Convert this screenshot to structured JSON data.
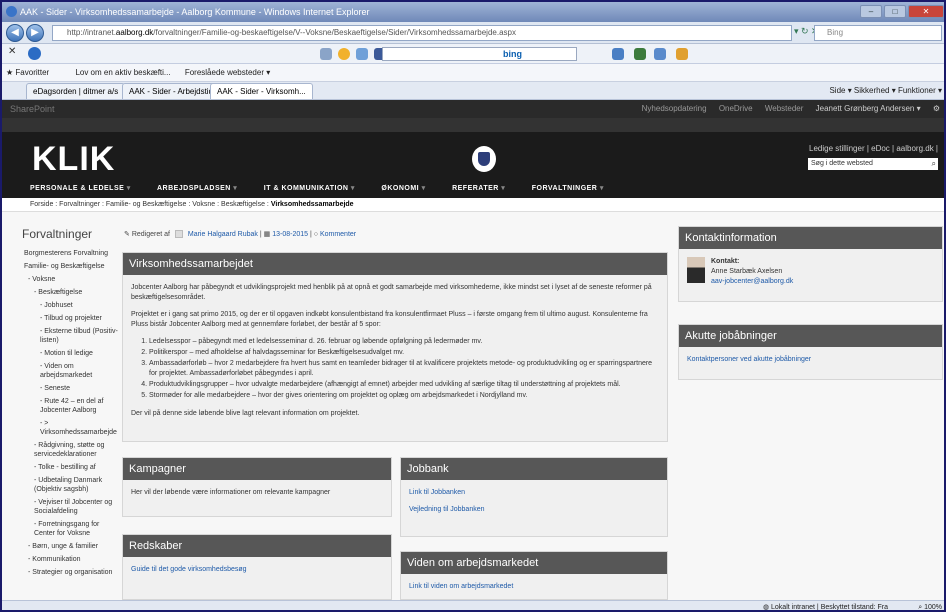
{
  "browser": {
    "title": "AAK - Sider - Virksomhedssamarbejde - Aalborg Kommune - Windows Internet Explorer",
    "url_prefix": "http://intranet.",
    "url_host": "aalborg.dk",
    "url_path": "/forvaltninger/Familie-og-beskaeftigelse/V--Voksne/Beskaeftigelse/Sider/Virksomhedssamarbejde.aspx",
    "search_placeholder": "Bing",
    "bing_label": "bing",
    "favorites_label": "Favoritter",
    "fav_items": [
      "Lov om en aktiv beskæfti...",
      "Foreslåede websteder ▾"
    ],
    "tabs": [
      "eDagsorden | ditmer a/s",
      "AAK - Sider - Arbejdstid - ...",
      "AAK - Sider - Virksomh..."
    ],
    "command_bar": "Side ▾   Sikkerhed ▾   Funktioner ▾",
    "status_zone": "Lokalt intranet | Beskyttet tilstand: Fra",
    "status_zoom": "100%"
  },
  "suite": {
    "brand": "SharePoint",
    "links": [
      "Nyhedsopdatering",
      "OneDrive",
      "Websteder"
    ],
    "user": "Jeanett Grønberg Andersen ▾"
  },
  "site": {
    "logo": "KLIK",
    "top_links": "Ledige stillinger  |  eDoc  |  aalborg.dk  |",
    "search_placeholder": "Søg i dette websted",
    "nav": [
      "PERSONALE & LEDELSE",
      "ARBEJDSPLADSEN",
      "IT & KOMMUNIKATION",
      "ØKONOMI",
      "REFERATER",
      "FORVALTNINGER"
    ]
  },
  "breadcrumb": {
    "path": "Forside : Forvaltninger : Familie- og Beskæftigelse : Voksne : Beskæftigelse : ",
    "current": "Virksomhedssamarbejde"
  },
  "leftnav": {
    "heading": "Forvaltninger",
    "items": [
      {
        "label": "Borgmesterens Forvaltning",
        "level": 1
      },
      {
        "label": "Familie- og Beskæftigelse",
        "level": 1
      },
      {
        "label": "- Voksne",
        "level": 2
      },
      {
        "label": "- Beskæftigelse",
        "level": 3
      },
      {
        "label": "- Jobhuset",
        "level": 4
      },
      {
        "label": "- Tilbud og projekter",
        "level": 4
      },
      {
        "label": "- Eksterne tilbud (Positiv-listen)",
        "level": 4
      },
      {
        "label": "- Motion til ledige",
        "level": 4
      },
      {
        "label": "- Viden om arbejdsmarkedet",
        "level": 4
      },
      {
        "label": "- Seneste",
        "level": 4
      },
      {
        "label": "- Rute 42 – en del af Jobcenter Aalborg",
        "level": 4
      },
      {
        "label": "- > Virksomhedssamarbejde",
        "level": 4
      },
      {
        "label": "- Rådgivning, støtte og servicedeklarationer",
        "level": 3
      },
      {
        "label": "- Tolke - bestilling af",
        "level": 3
      },
      {
        "label": "- Udbetaling Danmark (Objektiv sagsbh)",
        "level": 3
      },
      {
        "label": "- Vejviser til Jobcenter og Socialafdeling",
        "level": 3
      },
      {
        "label": "- Forretningsgang for Center for Voksne",
        "level": 3
      },
      {
        "label": "- Børn, unge & familier",
        "level": 2
      },
      {
        "label": "- Kommunikation",
        "level": 2
      },
      {
        "label": "- Strategier og organisation",
        "level": 2
      }
    ]
  },
  "meta": {
    "edited_by_label": "Redigeret af",
    "author": "Marie Halgaard Rubak",
    "date": "13-08-2015",
    "comments": "Kommenter"
  },
  "main_panel": {
    "title": "Virksomhedssamarbejdet",
    "p1": "Jobcenter Aalborg har påbegyndt et udviklingsprojekt med henblik på at opnå et godt samarbejde med virksomhederne, ikke mindst set i lyset af de seneste reformer på beskæftigelsesområdet.",
    "p2": "Projektet er i gang sat primo 2015, og der er til opgaven indkøbt konsulentbistand fra konsulentfirmaet Pluss – i første omgang frem til ultimo august. Konsulenterne fra Pluss bistår Jobcenter Aalborg med at gennemføre forløbet, der består af 5 spor:",
    "steps": [
      "Ledelsesspor – påbegyndt med et ledelsesseminar d. 26. februar og løbende opfølgning på ledermøder mv.",
      "Politikerspor – med afholdelse af halvdagsseminar for Beskæftigelsesudvalget mv.",
      "Ambassadørforløb – hvor 2 medarbejdere fra hvert hus samt en teamleder bidrager til at kvalificere projektets metode- og produktudvikling og er sparringspartnere for projektet. Ambassadørforløbet påbegyndes i april.",
      "Produktudviklingsgrupper – hvor udvalgte medarbejdere (afhængigt af emnet) arbejder med udvikling af særlige tiltag til understøttning af projektets mål.",
      "Stormøder for alle medarbejdere – hvor der gives orientering om projektet og oplæg om arbejdsmarkedet i Nordjylland mv."
    ],
    "p3": "Der vil på denne side løbende blive lagt relevant information om projektet."
  },
  "kampagner": {
    "title": "Kampagner",
    "text": "Her vil der løbende være informationer om relevante kampagner"
  },
  "jobbank": {
    "title": "Jobbank",
    "links": [
      "Link til Jobbanken",
      "Vejledning til Jobbanken"
    ]
  },
  "redskaber": {
    "title": "Redskaber",
    "link": "Guide til det gode virksomhedsbesøg"
  },
  "viden": {
    "title": "Viden om arbejdsmarkedet",
    "link": "Link til viden om arbejdsmarkedet"
  },
  "kontakt": {
    "title": "Kontaktinformation",
    "label": "Kontakt:",
    "name": "Anne Starbæk Axelsen",
    "email": "aav-jobcenter@aalborg.dk"
  },
  "jobaabninger": {
    "title": "Akutte jobåbninger",
    "link": "Kontaktpersoner ved akutte jobåbninger"
  }
}
